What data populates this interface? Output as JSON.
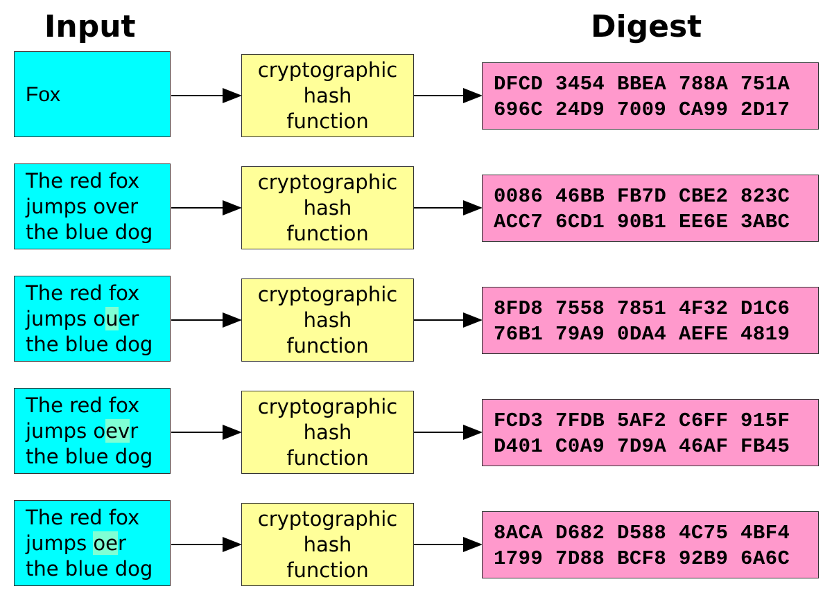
{
  "headings": {
    "input": "Input",
    "digest": "Digest"
  },
  "hash_label": [
    "cryptographic",
    "hash",
    "function"
  ],
  "colors": {
    "input_box": "#00ffff",
    "hash_box": "#ffff99",
    "digest_box": "#ff99cc",
    "highlight": "#7fffd4"
  },
  "rows": [
    {
      "input_lines": [
        {
          "parts": [
            {
              "text": "Fox"
            }
          ]
        }
      ],
      "digest_lines": [
        "DFCD 3454 BBEA 788A 751A",
        "696C 24D9 7009 CA99 2D17"
      ]
    },
    {
      "input_lines": [
        {
          "parts": [
            {
              "text": "The red fox"
            }
          ]
        },
        {
          "parts": [
            {
              "text": "jumps over"
            }
          ]
        },
        {
          "parts": [
            {
              "text": "the blue dog"
            }
          ]
        }
      ],
      "digest_lines": [
        "0086 46BB FB7D CBE2 823C",
        "ACC7 6CD1 90B1 EE6E 3ABC"
      ]
    },
    {
      "input_lines": [
        {
          "parts": [
            {
              "text": "The red fox"
            }
          ]
        },
        {
          "parts": [
            {
              "text": "jumps o"
            },
            {
              "text": "u",
              "highlight": true
            },
            {
              "text": "er"
            }
          ]
        },
        {
          "parts": [
            {
              "text": "the blue dog"
            }
          ]
        }
      ],
      "digest_lines": [
        "8FD8 7558 7851 4F32 D1C6",
        "76B1 79A9 0DA4 AEFE 4819"
      ]
    },
    {
      "input_lines": [
        {
          "parts": [
            {
              "text": "The red fox"
            }
          ]
        },
        {
          "parts": [
            {
              "text": "jumps o"
            },
            {
              "text": "ev",
              "highlight": true
            },
            {
              "text": "r"
            }
          ]
        },
        {
          "parts": [
            {
              "text": "the blue dog"
            }
          ]
        }
      ],
      "digest_lines": [
        "FCD3 7FDB 5AF2 C6FF 915F",
        "D401 C0A9 7D9A 46AF FB45"
      ]
    },
    {
      "input_lines": [
        {
          "parts": [
            {
              "text": "The red fox"
            }
          ]
        },
        {
          "parts": [
            {
              "text": "jumps "
            },
            {
              "text": "oe",
              "highlight": true
            },
            {
              "text": "r"
            }
          ]
        },
        {
          "parts": [
            {
              "text": "the blue dog"
            }
          ]
        }
      ],
      "digest_lines": [
        "8ACA D682 D588 4C75 4BF4",
        "1799 7D88 BCF8 92B9 6A6C"
      ]
    }
  ]
}
